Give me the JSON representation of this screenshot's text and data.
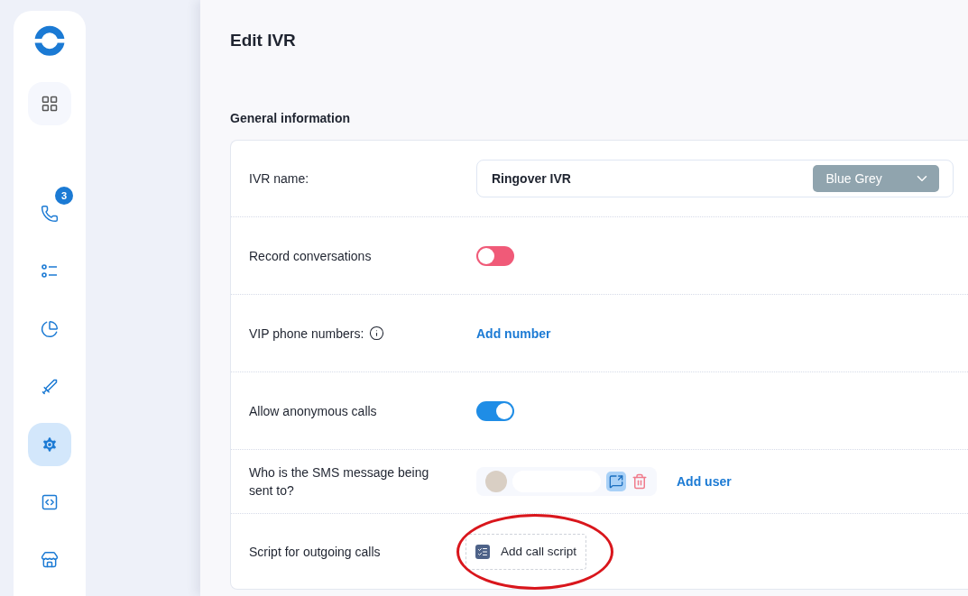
{
  "sidebar": {
    "items": [
      {
        "selected": false
      },
      {
        "selected": false,
        "badge": "3"
      },
      {
        "selected": false
      },
      {
        "selected": false
      },
      {
        "selected": false
      },
      {
        "selected": true
      },
      {
        "selected": false
      },
      {
        "selected": false
      }
    ]
  },
  "page": {
    "title": "Edit IVR"
  },
  "section": {
    "title": "General information"
  },
  "rows": [
    {
      "kind": "name",
      "label": "IVR name:",
      "value": "Ringover IVR",
      "color_select": {
        "value": "Blue Grey",
        "color": "#90a4ae"
      }
    },
    {
      "kind": "toggle",
      "label": "Record conversations",
      "on": false
    },
    {
      "kind": "link",
      "label": "VIP phone numbers:",
      "info": true,
      "link": "Add number"
    },
    {
      "kind": "toggle",
      "label": "Allow anonymous calls",
      "on": true
    },
    {
      "kind": "users",
      "label": "Who is the SMS message being sent to?",
      "link": "Add user"
    },
    {
      "kind": "script",
      "label": "Script for outgoing calls",
      "button": "Add call script",
      "highlighted": true
    }
  ]
}
